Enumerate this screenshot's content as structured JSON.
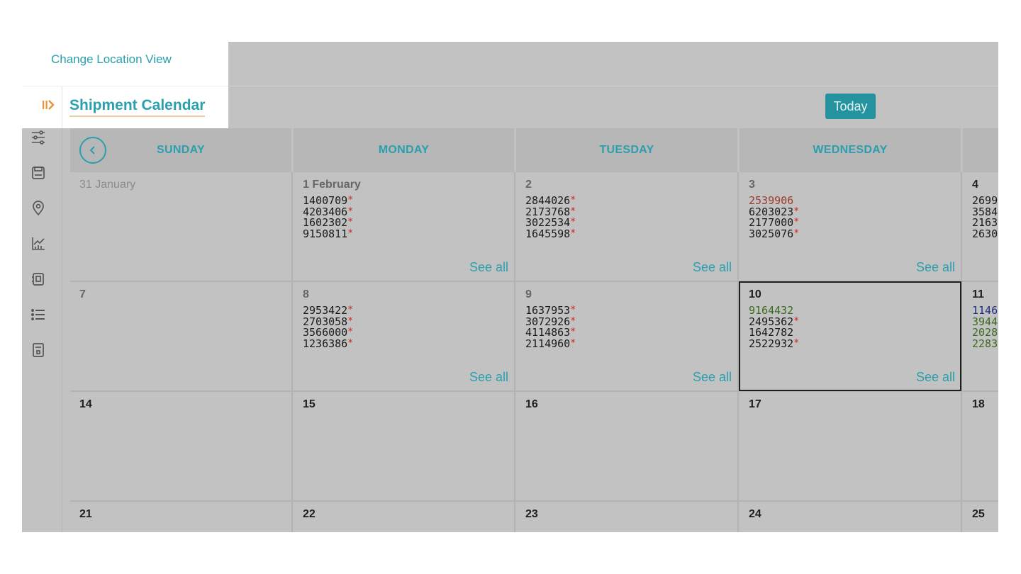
{
  "header": {
    "change_location_label": "Change Location View",
    "page_title": "Shipment Calendar",
    "today_label": "Today"
  },
  "colors": {
    "accent": "#2a9fae",
    "today_button": "#25929f",
    "required_star": "#d22020"
  },
  "sidebar": {
    "items": [
      {
        "name": "filters",
        "icon": "sliders-icon"
      },
      {
        "name": "save",
        "icon": "floppy-disk-icon"
      },
      {
        "name": "location",
        "icon": "map-pin-icon"
      },
      {
        "name": "analytics",
        "icon": "bar-chart-icon"
      },
      {
        "name": "device",
        "icon": "device-icon"
      },
      {
        "name": "list",
        "icon": "list-icon"
      },
      {
        "name": "report",
        "icon": "document-icon"
      }
    ]
  },
  "calendar": {
    "days": [
      "SUNDAY",
      "MONDAY",
      "TUESDAY",
      "WEDNESDAY"
    ],
    "see_all_label": "See all",
    "weeks": [
      [
        {
          "date": "31 January",
          "shipments": []
        },
        {
          "date": "1 February",
          "shipments": [
            {
              "id": "1400709",
              "flag": true
            },
            {
              "id": "4203406",
              "flag": true
            },
            {
              "id": "1602302",
              "flag": true
            },
            {
              "id": "9150811",
              "flag": true
            }
          ],
          "see_all": true
        },
        {
          "date": "2",
          "shipments": [
            {
              "id": "2844026",
              "flag": true
            },
            {
              "id": "2173768",
              "flag": true
            },
            {
              "id": "3022534",
              "flag": true
            },
            {
              "id": "1645598",
              "flag": true
            }
          ],
          "see_all": true
        },
        {
          "date": "3",
          "shipments": [
            {
              "id": "2539906",
              "flag": false,
              "color": "red"
            },
            {
              "id": "6203023",
              "flag": true
            },
            {
              "id": "2177000",
              "flag": true
            },
            {
              "id": "3025076",
              "flag": true
            }
          ],
          "see_all": true
        },
        {
          "date": "4",
          "shipments": [
            {
              "id": "2699"
            },
            {
              "id": "3584"
            },
            {
              "id": "2163"
            },
            {
              "id": "2630"
            }
          ]
        }
      ],
      [
        {
          "date": "7",
          "shipments": []
        },
        {
          "date": "8",
          "shipments": [
            {
              "id": "2953422",
              "flag": true
            },
            {
              "id": "2703058",
              "flag": true
            },
            {
              "id": "3566000",
              "flag": true
            },
            {
              "id": "1236386",
              "flag": true
            }
          ],
          "see_all": true
        },
        {
          "date": "9",
          "shipments": [
            {
              "id": "1637953",
              "flag": true
            },
            {
              "id": "3072926",
              "flag": true
            },
            {
              "id": "4114863",
              "flag": true
            },
            {
              "id": "2114960",
              "flag": true
            }
          ],
          "see_all": true
        },
        {
          "date": "10",
          "selected": true,
          "shipments": [
            {
              "id": "9164432",
              "flag": false,
              "color": "green"
            },
            {
              "id": "2495362",
              "flag": true
            },
            {
              "id": "1642782",
              "flag": false
            },
            {
              "id": "2522932",
              "flag": true
            }
          ],
          "see_all": true
        },
        {
          "date": "11",
          "shipments": [
            {
              "id": "1146",
              "color": "blue"
            },
            {
              "id": "3944",
              "color": "green"
            },
            {
              "id": "2028",
              "color": "green"
            },
            {
              "id": "2283",
              "color": "green"
            }
          ]
        }
      ],
      [
        {
          "date": "14",
          "shipments": []
        },
        {
          "date": "15",
          "shipments": []
        },
        {
          "date": "16",
          "shipments": []
        },
        {
          "date": "17",
          "shipments": []
        },
        {
          "date": "18",
          "shipments": []
        }
      ],
      [
        {
          "date": "21",
          "shipments": []
        },
        {
          "date": "22",
          "shipments": []
        },
        {
          "date": "23",
          "shipments": []
        },
        {
          "date": "24",
          "shipments": []
        },
        {
          "date": "25",
          "shipments": []
        }
      ]
    ]
  }
}
